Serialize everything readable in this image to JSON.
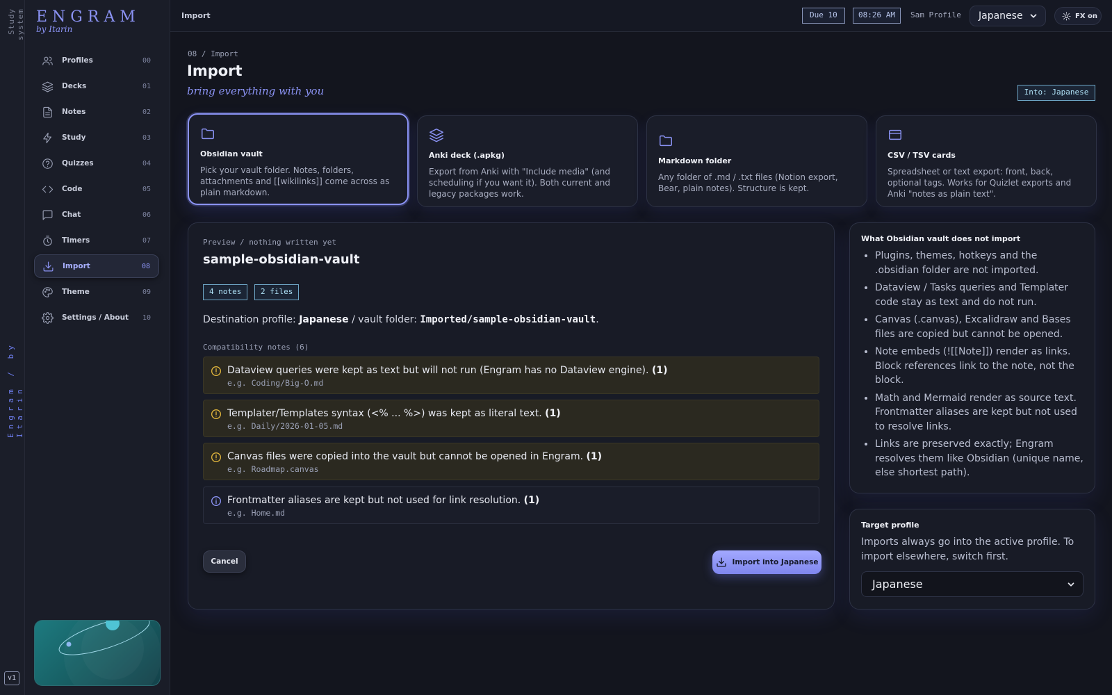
{
  "rail": {
    "top_label": "Study system",
    "mid_label": "Engram / by Itarin",
    "version": "v1"
  },
  "brand": {
    "name": "ENGRAM",
    "by": "by Itarin"
  },
  "nav": [
    {
      "label": "Profiles",
      "num": "00",
      "icon": "users-icon"
    },
    {
      "label": "Decks",
      "num": "01",
      "icon": "layers-icon"
    },
    {
      "label": "Notes",
      "num": "02",
      "icon": "document-icon"
    },
    {
      "label": "Study",
      "num": "03",
      "icon": "bolt-icon"
    },
    {
      "label": "Quizzes",
      "num": "04",
      "icon": "question-icon"
    },
    {
      "label": "Code",
      "num": "05",
      "icon": "code-icon"
    },
    {
      "label": "Chat",
      "num": "06",
      "icon": "chat-icon"
    },
    {
      "label": "Timers",
      "num": "07",
      "icon": "timer-icon"
    },
    {
      "label": "Import",
      "num": "08",
      "icon": "download-icon",
      "active": true
    },
    {
      "label": "Theme",
      "num": "09",
      "icon": "palette-icon"
    },
    {
      "label": "Settings / About",
      "num": "10",
      "icon": "gear-icon"
    }
  ],
  "topbar": {
    "title": "Import",
    "due": "Due 10",
    "time": "08:26 AM",
    "user": "Sam Profile",
    "profile": "Japanese",
    "fx": "FX on"
  },
  "page": {
    "crumb": "08 / Import",
    "title": "Import",
    "subtitle": "bring everything with you",
    "into": "Into: Japanese"
  },
  "sources": [
    {
      "title": "Obsidian vault",
      "desc": "Pick your vault folder. Notes, folders, attachments and [[wikilinks]] come across as plain markdown.",
      "icon": "folder-icon"
    },
    {
      "title": "Anki deck (.apkg)",
      "desc": "Export from Anki with \"Include media\" (and scheduling if you want it). Both current and legacy packages work.",
      "icon": "layers-icon"
    },
    {
      "title": "Markdown folder",
      "desc": "Any folder of .md / .txt files (Notion export, Bear, plain notes). Structure is kept.",
      "icon": "folder-icon"
    },
    {
      "title": "CSV / TSV cards",
      "desc": "Spreadsheet or text export: front, back, optional tags. Works for Quizlet exports and Anki \"notes as plain text\".",
      "icon": "card-icon"
    }
  ],
  "preview": {
    "label": "Preview / nothing written yet",
    "title": "sample-obsidian-vault",
    "tags": [
      "4 notes",
      "2 files"
    ],
    "dest_prefix": "Destination profile:",
    "dest_profile": "Japanese",
    "dest_mid": "/ vault folder:",
    "dest_folder": "Imported/sample-obsidian-vault",
    "dest_end": ".",
    "compat_header": "Compatibility notes (6)",
    "notes": [
      {
        "kind": "warn",
        "text": "Dataview queries were kept as text but will not run (Engram has no Dataview engine).",
        "count": "(1)",
        "example": "e.g. Coding/Big-O.md"
      },
      {
        "kind": "warn",
        "text": "Templater/Templates syntax (<% ... %>) was kept as literal text.",
        "count": "(1)",
        "example": "e.g. Daily/2026-01-05.md"
      },
      {
        "kind": "warn",
        "text": "Canvas files were copied into the vault but cannot be opened in Engram.",
        "count": "(1)",
        "example": "e.g. Roadmap.canvas"
      },
      {
        "kind": "info",
        "text": "Frontmatter aliases are kept but not used for link resolution.",
        "count": "(1)",
        "example": "e.g. Home.md"
      }
    ],
    "cancel": "Cancel",
    "import": "Import into Japanese"
  },
  "not_import": {
    "title": "What Obsidian vault does not import",
    "items": [
      "Plugins, themes, hotkeys and the .obsidian folder are not imported.",
      "Dataview / Tasks queries and Templater code stay as text and do not run.",
      "Canvas (.canvas), Excalidraw and Bases files are copied but cannot be opened.",
      "Note embeds (![[Note]]) render as links. Block references link to the note, not the block.",
      "Math and Mermaid render as source text. Frontmatter aliases are kept but not used to resolve links.",
      "Links are preserved exactly; Engram resolves them like Obsidian (unique name, else shortest path)."
    ]
  },
  "target": {
    "title": "Target profile",
    "desc": "Imports always go into the active profile. To import elsewhere, switch first.",
    "selected": "Japanese"
  },
  "colors": {
    "accent": "#8b93f4",
    "bg": "#13151e",
    "warn": "#e0b53c",
    "info": "#8b93f4"
  }
}
